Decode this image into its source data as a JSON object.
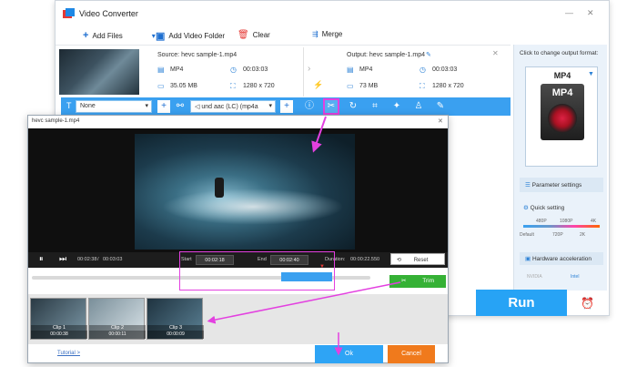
{
  "app": {
    "title": "Video Converter"
  },
  "toolbar": {
    "add_files": "Add Files",
    "add_video_folder": "Add Video Folder",
    "clear": "Clear",
    "merge": "Merge"
  },
  "file": {
    "source_label": "Source: hevc sample-1.mp4",
    "output_label": "Output: hevc sample-1.mp4",
    "src_format": "MP4",
    "src_duration": "00:03:03",
    "src_size": "35.05 MB",
    "src_resolution": "1280 x 720",
    "out_format": "MP4",
    "out_duration": "00:03:03",
    "out_size": "73 MB",
    "out_resolution": "1280 x 720"
  },
  "editbar": {
    "subtitle": "None",
    "audio": "und aac (LC) (mp4a"
  },
  "right_panel": {
    "change_format": "Click to change output format:",
    "format": "MP4",
    "parameter_settings": "Parameter settings",
    "quick_setting": "Quick setting",
    "q_top": [
      "480P",
      "1080P",
      "4K"
    ],
    "q_bottom": [
      "Default",
      "720P",
      "2K"
    ],
    "hw_accel": "Hardware acceleration",
    "nvidia": "NVIDIA",
    "intel": "Intel"
  },
  "run": {
    "label": "Run"
  },
  "dialog": {
    "title": "hevc sample-1.mp4",
    "current_time": "00:02:38",
    "sep": "/",
    "total_time": "00:03:03",
    "start_label": "Start",
    "start_value": "00:02:18",
    "end_label": "End",
    "end_value": "00:02:40",
    "duration_label": "Duration:",
    "duration_value": "00:00:22.550",
    "reset": "Reset",
    "trim": "Trim",
    "tutorial": "Tutorial >",
    "ok": "Ok",
    "cancel": "Cancel",
    "clips": [
      {
        "label": "Clip 1",
        "time": "00:00:38"
      },
      {
        "label": "Clip 2",
        "time": "00:00:11"
      },
      {
        "label": "Clip 3",
        "time": "00:00:09"
      }
    ]
  },
  "colors": {
    "accent": "#27a3f5",
    "annotation": "#e340e0",
    "trim": "#35b135",
    "cancel": "#f07a1c"
  }
}
